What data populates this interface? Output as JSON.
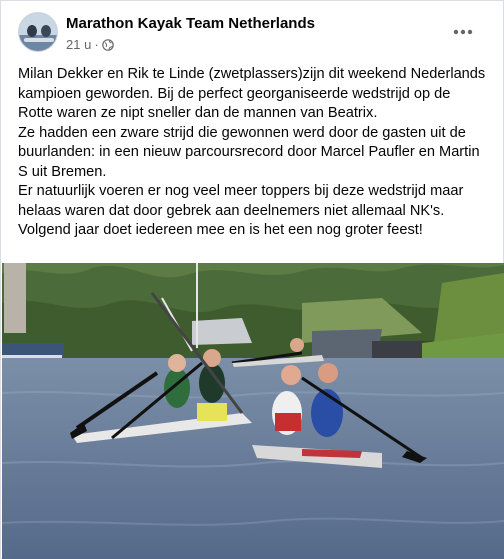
{
  "post": {
    "author": "Marathon Kayak Team Netherlands",
    "time": "21 u",
    "separator": "·",
    "privacy_icon": "globe-icon",
    "more_icon": "more-horizontal-icon",
    "paragraphs": [
      "Milan Dekker en Rik te Linde (zwetplassers)zijn dit weekend Nederlands kampioen geworden. Bij de perfect georganiseerde wedstrijd op de Rotte waren ze nipt sneller dan de mannen van Beatrix.",
      "Ze hadden een zware strijd die gewonnen werd door de gasten uit de buurlanden: in een nieuw parcoursrecord door Marcel Paufler en Martin S uit Bremen.",
      "Er natuurlijk voeren er nog veel meer toppers bij deze wedstrijd maar helaas waren dat door gebrek aan deelnemers niet allemaal NK's.",
      "Volgend jaar doet iedereen mee en is het een nog groter feest!"
    ]
  },
  "colors": {
    "text": "#050505",
    "secondary": "#65676b",
    "water": "#5d7494",
    "trees": "#3b5a2e"
  }
}
